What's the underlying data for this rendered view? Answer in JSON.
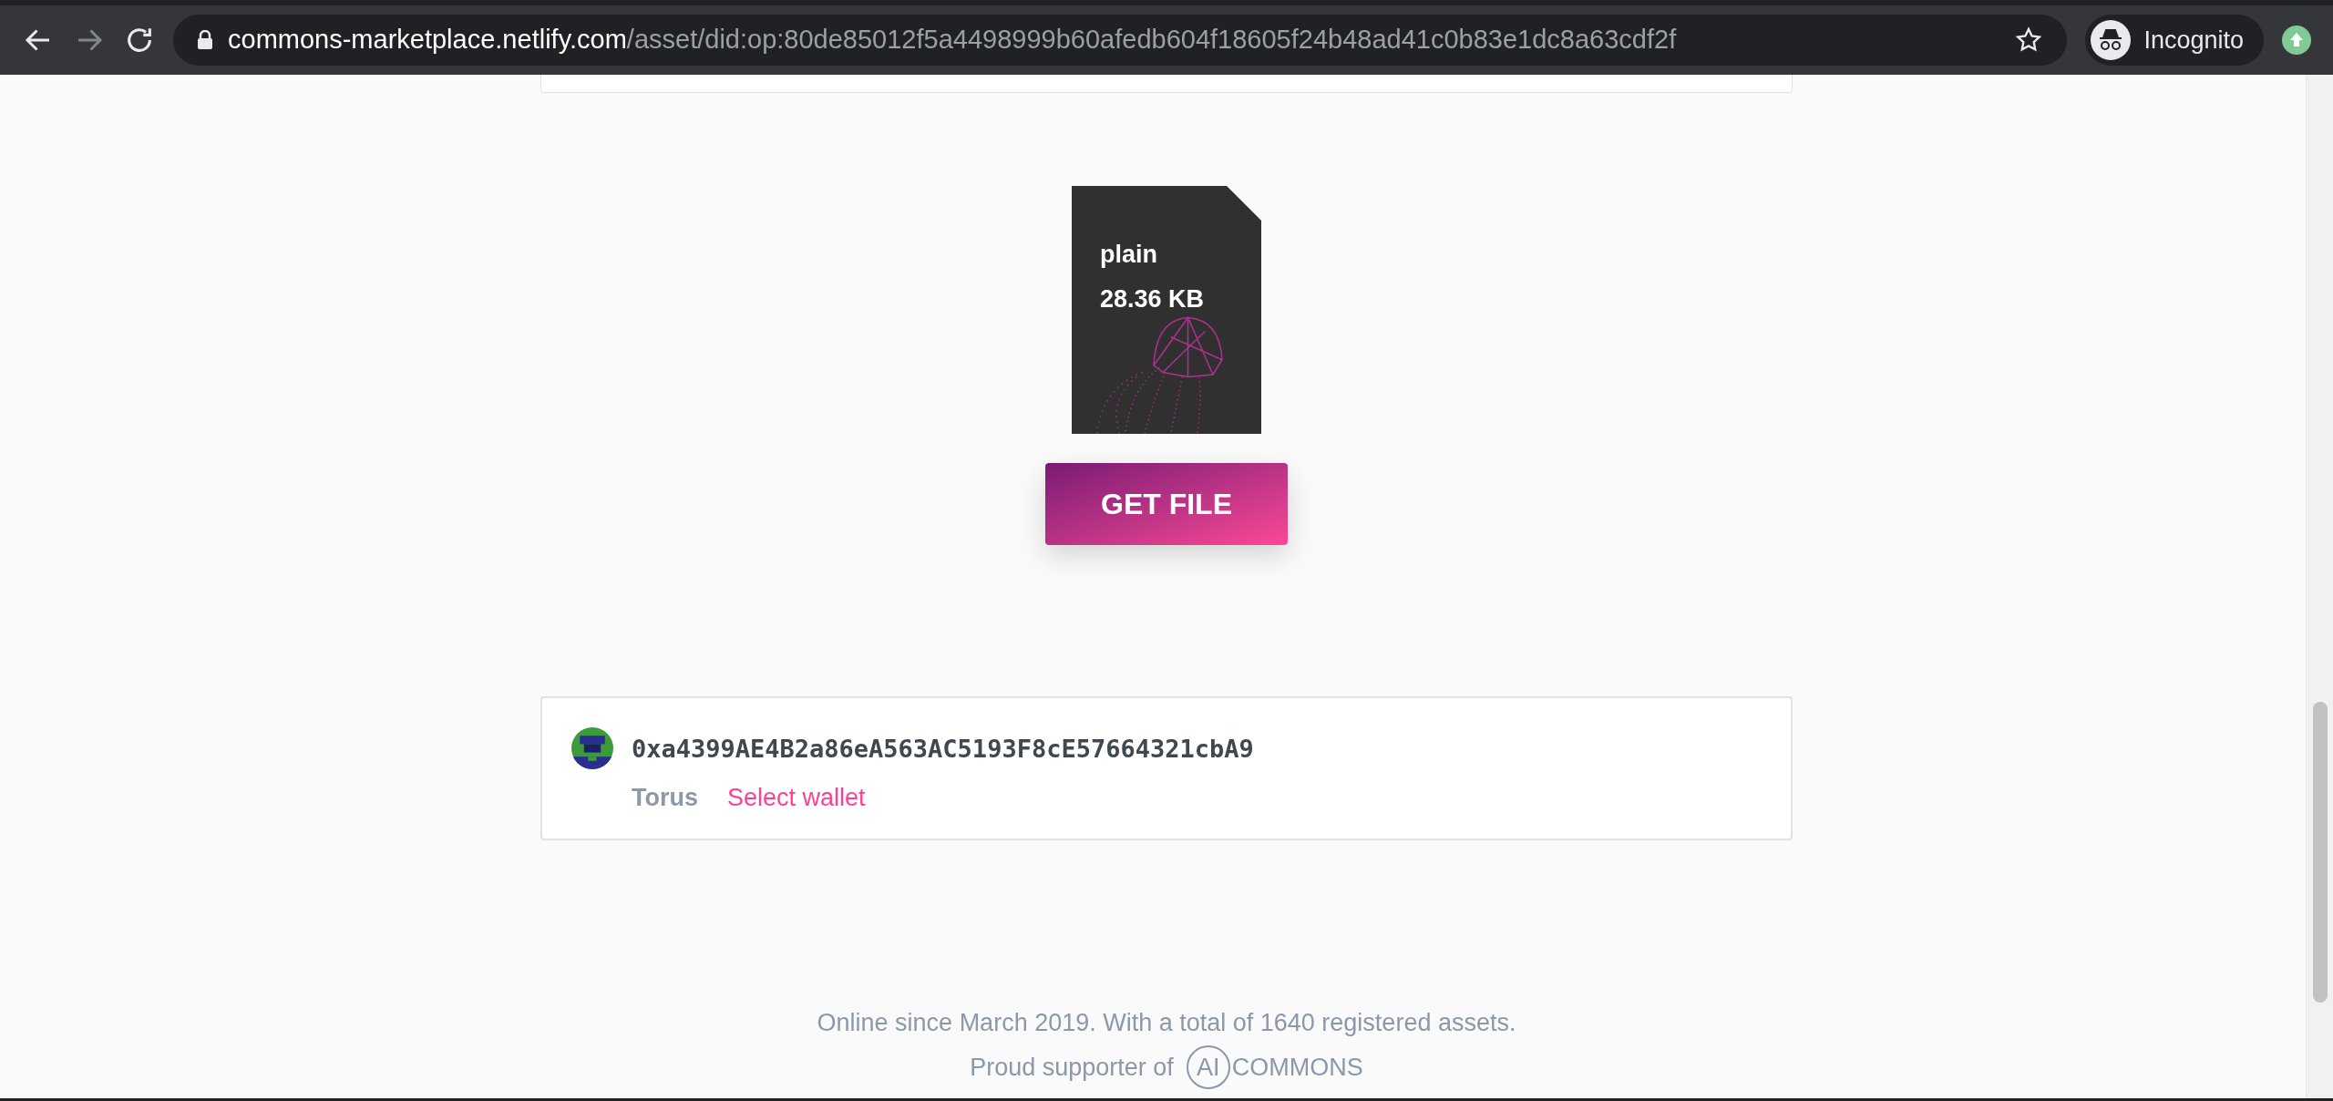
{
  "browser": {
    "forward_disabled": true,
    "url_domain": "commons-marketplace.netlify.com",
    "url_path": "/asset/did:op:80de85012f5a4498999b60afedb604f18605f24b48ad41c0b83e1dc8a63cdf2f",
    "profile_label": "Incognito"
  },
  "file": {
    "type": "plain",
    "size": "28.36 KB",
    "button": "GET FILE"
  },
  "wallet": {
    "address": "0xa4399AE4B2a86eA563AC5193F8cE57664321cbA9",
    "provider": "Torus",
    "action": "Select wallet"
  },
  "footer": {
    "stats": "Online since March 2019. With a total of 1640 registered assets.",
    "supporter_prefix": "Proud supporter of",
    "logo_mark": "AI",
    "logo_text": "COMMONS"
  }
}
